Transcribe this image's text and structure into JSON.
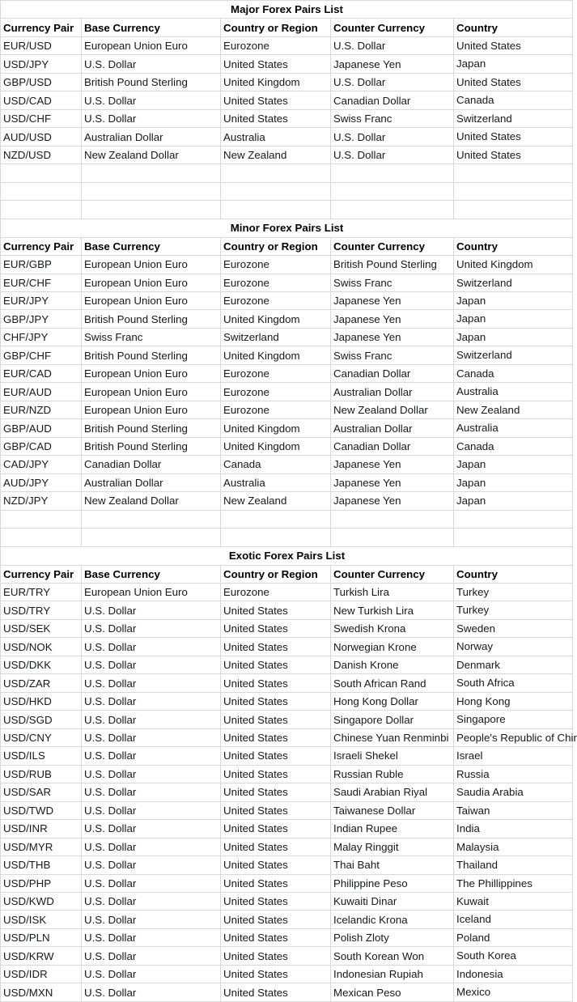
{
  "document": {
    "type": "spreadsheet-table",
    "columns": [
      "Currency Pair",
      "Base Currency",
      "Country or Region",
      "Counter Currency",
      "Country"
    ],
    "text_color": "#16181f",
    "border_color": "#d9d9d9",
    "background": "#ffffff"
  },
  "sections": [
    {
      "title": "Major Forex Pairs List",
      "headers": [
        "Currency Pair",
        "Base Currency",
        "Country or Region",
        "Counter Currency",
        "Country"
      ],
      "rows": [
        [
          "EUR/USD",
          "European Union Euro",
          "Eurozone",
          "U.S. Dollar",
          "United States"
        ],
        [
          "USD/JPY",
          "U.S. Dollar",
          "United States",
          "Japanese Yen",
          "Japan"
        ],
        [
          "GBP/USD",
          "British Pound Sterling",
          "United Kingdom",
          "U.S. Dollar",
          "United States"
        ],
        [
          "USD/CAD",
          "U.S. Dollar",
          "United States",
          "Canadian Dollar",
          "Canada"
        ],
        [
          "USD/CHF",
          "U.S. Dollar",
          "United States",
          "Swiss Franc",
          "Switzerland"
        ],
        [
          "AUD/USD",
          "Australian Dollar",
          "Australia",
          "U.S. Dollar",
          "United States"
        ],
        [
          "NZD/USD",
          "New Zealand Dollar",
          "New Zealand",
          "U.S. Dollar",
          "United States"
        ]
      ],
      "blank_rows_after": 3
    },
    {
      "title": "Minor Forex Pairs List",
      "headers": [
        "Currency Pair",
        "Base Currency",
        "Country or Region",
        "Counter Currency",
        "Country"
      ],
      "rows": [
        [
          "EUR/GBP",
          "European Union Euro",
          "Eurozone",
          "British Pound Sterling",
          "United Kingdom"
        ],
        [
          "EUR/CHF",
          "European Union Euro",
          "Eurozone",
          "Swiss Franc",
          "Switzerland"
        ],
        [
          "EUR/JPY",
          "European Union Euro",
          "Eurozone",
          "Japanese Yen",
          "Japan"
        ],
        [
          "GBP/JPY",
          "British Pound Sterling",
          "United Kingdom",
          "Japanese Yen",
          "Japan"
        ],
        [
          "CHF/JPY",
          "Swiss Franc",
          "Switzerland",
          "Japanese Yen",
          "Japan"
        ],
        [
          "GBP/CHF",
          "British Pound Sterling",
          "United Kingdom",
          "Swiss Franc",
          "Switzerland"
        ],
        [
          "EUR/CAD",
          "European Union Euro",
          "Eurozone",
          "Canadian Dollar",
          "Canada"
        ],
        [
          "EUR/AUD",
          "European Union Euro",
          "Eurozone",
          "Australian Dollar",
          "Australia"
        ],
        [
          "EUR/NZD",
          "European Union Euro",
          "Eurozone",
          "New Zealand Dollar",
          "New Zealand"
        ],
        [
          "GBP/AUD",
          "British Pound Sterling",
          "United Kingdom",
          "Australian Dollar",
          "Australia"
        ],
        [
          "GBP/CAD",
          "British Pound Sterling",
          "United Kingdom",
          "Canadian Dollar",
          "Canada"
        ],
        [
          "CAD/JPY",
          "Canadian Dollar",
          "Canada",
          "Japanese Yen",
          "Japan"
        ],
        [
          "AUD/JPY",
          "Australian Dollar",
          "Australia",
          "Japanese Yen",
          "Japan"
        ],
        [
          "NZD/JPY",
          "New Zealand Dollar",
          "New Zealand",
          "Japanese Yen",
          "Japan"
        ]
      ],
      "blank_rows_after": 2
    },
    {
      "title": "Exotic Forex Pairs List",
      "headers": [
        "Currency Pair",
        "Base Currency",
        "Country or Region",
        "Counter Currency",
        "Country"
      ],
      "rows": [
        [
          "EUR/TRY",
          "European Union Euro",
          "Eurozone",
          "Turkish Lira",
          "Turkey"
        ],
        [
          "USD/TRY",
          "U.S. Dollar",
          "United States",
          "New Turkish Lira",
          "Turkey"
        ],
        [
          "USD/SEK",
          "U.S. Dollar",
          "United States",
          "Swedish Krona",
          "Sweden"
        ],
        [
          "USD/NOK",
          "U.S. Dollar",
          "United States",
          "Norwegian Krone",
          "Norway"
        ],
        [
          "USD/DKK",
          "U.S. Dollar",
          "United States",
          "Danish Krone",
          "Denmark"
        ],
        [
          "USD/ZAR",
          "U.S. Dollar",
          "United States",
          "South African Rand",
          "South Africa"
        ],
        [
          "USD/HKD",
          "U.S. Dollar",
          "United States",
          "Hong Kong Dollar",
          "Hong Kong"
        ],
        [
          "USD/SGD",
          "U.S. Dollar",
          "United States",
          "Singapore Dollar",
          "Singapore"
        ],
        [
          "USD/CNY",
          "U.S. Dollar",
          "United States",
          "Chinese Yuan Renminbi",
          "People's Republic of China"
        ],
        [
          "USD/ILS",
          "U.S. Dollar",
          "United States",
          "Israeli Shekel",
          "Israel"
        ],
        [
          "USD/RUB",
          "U.S. Dollar",
          "United States",
          "Russian Ruble",
          "Russia"
        ],
        [
          "USD/SAR",
          "U.S. Dollar",
          "United States",
          "Saudi Arabian Riyal",
          "Saudia Arabia"
        ],
        [
          "USD/TWD",
          "U.S. Dollar",
          "United States",
          "Taiwanese Dollar",
          "Taiwan"
        ],
        [
          "USD/INR",
          "U.S. Dollar",
          "United States",
          "Indian Rupee",
          "India"
        ],
        [
          "USD/MYR",
          "U.S. Dollar",
          "United States",
          "Malay Ringgit",
          "Malaysia"
        ],
        [
          "USD/THB",
          "U.S. Dollar",
          "United States",
          "Thai Baht",
          "Thailand"
        ],
        [
          "USD/PHP",
          "U.S. Dollar",
          "United States",
          "Philippine Peso",
          "The Phillippines"
        ],
        [
          "USD/KWD",
          "U.S. Dollar",
          "United States",
          "Kuwaiti Dinar",
          "Kuwait"
        ],
        [
          "USD/ISK",
          "U.S. Dollar",
          "United States",
          "Icelandic Krona",
          "Iceland"
        ],
        [
          "USD/PLN",
          "U.S. Dollar",
          "United States",
          "Polish Zloty",
          "Poland"
        ],
        [
          "USD/KRW",
          "U.S. Dollar",
          "United States",
          "South Korean Won",
          "South Korea"
        ],
        [
          "USD/IDR",
          "U.S. Dollar",
          "United States",
          "Indonesian Rupiah",
          "Indonesia"
        ],
        [
          "USD/MXN",
          "U.S. Dollar",
          "United States",
          "Mexican Peso",
          "Mexico"
        ]
      ],
      "blank_rows_after": 0
    }
  ]
}
